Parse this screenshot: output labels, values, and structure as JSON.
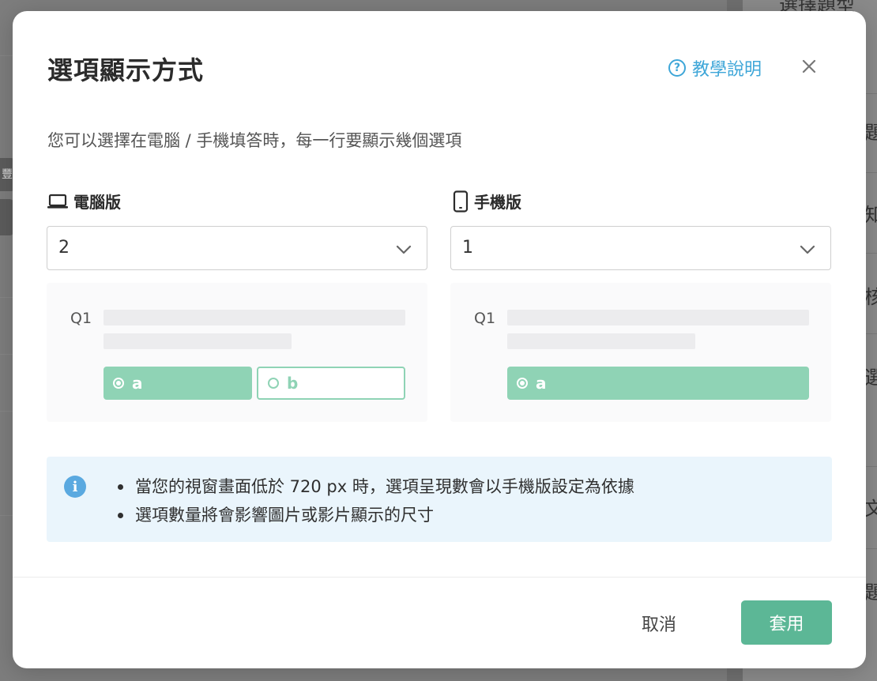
{
  "background": {
    "top_title": "選擇題型",
    "left_tab": "豐",
    "right_chars": [
      "題",
      "知",
      "核",
      "選",
      "文",
      "題"
    ]
  },
  "modal": {
    "title": "選項顯示方式",
    "help_label": "教學說明",
    "subtitle": "您可以選擇在電腦 / 手機填答時，每一行要顯示幾個選項",
    "desktop": {
      "label": "電腦版",
      "selected_value": "2",
      "preview": {
        "question_label": "Q1",
        "options": [
          {
            "label": "a",
            "selected": true
          },
          {
            "label": "b",
            "selected": false
          }
        ]
      }
    },
    "mobile": {
      "label": "手機版",
      "selected_value": "1",
      "preview": {
        "question_label": "Q1",
        "options": [
          {
            "label": "a",
            "selected": true
          }
        ]
      }
    },
    "info": {
      "icon": "info-icon",
      "items": [
        "當您的視窗畫面低於 720 px 時，選項呈現數會以手機版設定為依據",
        "選項數量將會影響圖片或影片顯示的尺寸"
      ]
    },
    "footer": {
      "cancel_label": "取消",
      "apply_label": "套用"
    }
  },
  "colors": {
    "accent_green": "#5cb796",
    "option_green": "#8fd3b5",
    "link_blue": "#3ea6d8",
    "info_bg": "#eaf5fc"
  }
}
